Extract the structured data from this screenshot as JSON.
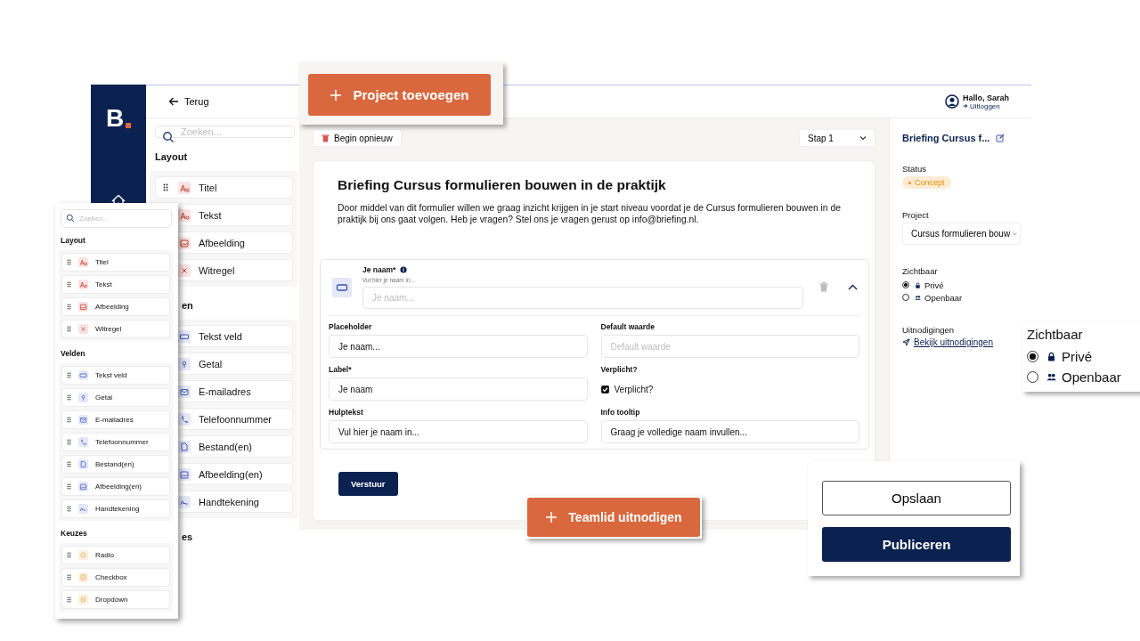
{
  "app": {
    "logo": "B"
  },
  "header": {
    "back": "Terug",
    "greeting": "Hallo, Sarah",
    "logout": "Uitloggen"
  },
  "sidebar": {
    "search_placeholder": "Zoeken...",
    "groups": [
      {
        "title": "Layout",
        "items": [
          {
            "label": "Titel",
            "kind": "text"
          },
          {
            "label": "Tekst",
            "kind": "text"
          },
          {
            "label": "Afbeelding",
            "kind": "image"
          },
          {
            "label": "Witregel",
            "kind": "spacer"
          }
        ]
      },
      {
        "title": "en",
        "items": [
          {
            "label": "Tekst veld",
            "kind": "textfield"
          },
          {
            "label": "Getal",
            "kind": "number"
          },
          {
            "label": "E-mailadres",
            "kind": "email"
          },
          {
            "label": "Telefoonnummer",
            "kind": "phone"
          },
          {
            "label": "Bestand(en)",
            "kind": "file"
          },
          {
            "label": "Afbeelding(en)",
            "kind": "images"
          },
          {
            "label": "Handtekening",
            "kind": "signature"
          }
        ]
      },
      {
        "title": "es"
      }
    ]
  },
  "toolbar": {
    "restart": "Begin opnieuw",
    "step": "Stap 1"
  },
  "form": {
    "title": "Briefing Cursus formulieren bouwen in de praktijk",
    "intro": "Door middel van dit formulier willen we graag inzicht krijgen in je start niveau voordat je de Cursus formulieren bouwen in de praktijk bij ons gaat volgen. Heb je vragen? Stel ons je vragen gerust op info@briefing.nl.",
    "field": {
      "label": "Je naam*",
      "help": "Vul hier je naam in...",
      "placeholder": "Je naam...",
      "expanded": true,
      "settings": [
        {
          "kind": "input",
          "label": "Placeholder",
          "value": "Je naam..."
        },
        {
          "kind": "input",
          "label": "Default waarde",
          "placeholder": "Default waarde"
        },
        {
          "kind": "input",
          "label": "Label*",
          "value": "Je naam"
        },
        {
          "kind": "checkbox",
          "label": "Verplicht?",
          "option": "Verplicht?",
          "checked": true
        },
        {
          "kind": "input",
          "label": "Hulptekst",
          "value": "Vul hier je naam in..."
        },
        {
          "kind": "input",
          "label": "Info tooltip",
          "value": "Graag je volledige naam invullen..."
        }
      ]
    },
    "submit": "Verstuur"
  },
  "details": {
    "title": "Briefing Cursus f...",
    "status_label": "Status",
    "status": "Concept",
    "project_label": "Project",
    "project": "Cursus formulieren bouw",
    "visibility_label": "Zichtbaar",
    "visibility": [
      {
        "label": "Privé",
        "selected": true
      },
      {
        "label": "Openbaar",
        "selected": false
      }
    ],
    "invites_label": "Uitnodigingen",
    "invites_link": "Bekijk uitnodigingen"
  },
  "callouts": {
    "add_project": "Project toevoegen",
    "invite": "Teamlid uitnodigen",
    "visibility": {
      "title": "Zichtbaar",
      "options": [
        {
          "label": "Privé",
          "selected": true
        },
        {
          "label": "Openbaar",
          "selected": false
        }
      ]
    },
    "save": "Opslaan",
    "publish": "Publiceren"
  },
  "floating_panel": {
    "search_placeholder": "Zoeken...",
    "groups": [
      {
        "title": "Layout",
        "items": [
          {
            "label": "Titel",
            "kind": "text"
          },
          {
            "label": "Tekst",
            "kind": "text"
          },
          {
            "label": "Afbeelding",
            "kind": "image"
          },
          {
            "label": "Witregel",
            "kind": "spacer"
          }
        ]
      },
      {
        "title": "Velden",
        "items": [
          {
            "label": "Tekst veld",
            "kind": "textfield"
          },
          {
            "label": "Getal",
            "kind": "number"
          },
          {
            "label": "E-mailadres",
            "kind": "email"
          },
          {
            "label": "Telefoonnummer",
            "kind": "phone"
          },
          {
            "label": "Bestand(en)",
            "kind": "file"
          },
          {
            "label": "Afbeelding(en)",
            "kind": "images"
          },
          {
            "label": "Handtekening",
            "kind": "signature"
          }
        ]
      },
      {
        "title": "Keuzes",
        "items": [
          {
            "label": "Radio",
            "kind": "radio"
          },
          {
            "label": "Checkbox",
            "kind": "checkbox"
          },
          {
            "label": "Dropdown",
            "kind": "dropdown"
          }
        ]
      }
    ]
  }
}
